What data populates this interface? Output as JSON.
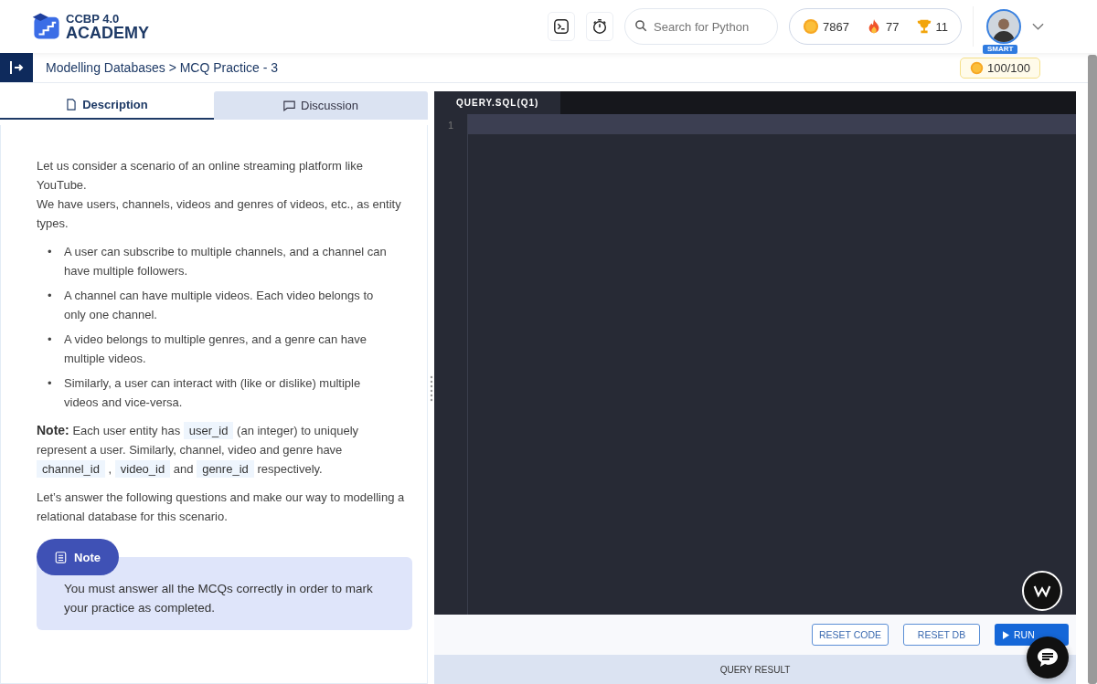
{
  "header": {
    "logo_top": "CCBP 4.0",
    "logo_bottom": "ACADEMY",
    "search": {
      "placeholder": "Search for Python"
    },
    "stats": [
      {
        "kind": "xp",
        "value": "7867"
      },
      {
        "kind": "streak",
        "value": "77"
      },
      {
        "kind": "trophy",
        "value": "11"
      }
    ],
    "avatar_badge": "SMART"
  },
  "breadcrumb": "Modelling Databases > MCQ Practice - 3",
  "xp_earned": "100/100",
  "tabs": [
    {
      "label": "Description",
      "kind": "doc",
      "selected": true
    },
    {
      "label": "Discussion",
      "kind": "chat",
      "selected": false
    }
  ],
  "description": {
    "intro": [
      "Let us consider a scenario of an online streaming platform like YouTube.",
      "We have users, channels, videos and genres of videos, etc., as entity types."
    ],
    "bullets": [
      {
        "marker": "•",
        "text": "A user can subscribe to multiple channels, and a channel can have multiple followers."
      },
      {
        "marker": "•",
        "text": "A channel can have multiple videos. Each video belongs to only one channel."
      },
      {
        "marker": "•",
        "text": "A video belongs to multiple genres, and a genre can have multiple videos."
      },
      {
        "marker": "•",
        "text": "Similarly, a user can interact with (like or dislike) multiple videos and vice-versa."
      }
    ],
    "note_paragraph": [
      {
        "kind": "text",
        "text": "**Note:** Each user entity has"
      },
      {
        "kind": "code",
        "text": "user_id"
      },
      {
        "kind": "text",
        "text": "(an integer) to uniquely represent a user. Similarly, channel, video and genre have"
      },
      {
        "kind": "code",
        "text": "channel_id"
      },
      {
        "kind": "text",
        "text": ","
      },
      {
        "kind": "code",
        "text": "video_id"
      },
      {
        "kind": "text",
        "text": "and"
      },
      {
        "kind": "code",
        "text": "genre_id"
      },
      {
        "kind": "text",
        "text": "respectively."
      }
    ],
    "closing": "Let’s answer the following questions and make our way to modelling a relational database for this scenario.",
    "note_box": {
      "title": "Note",
      "text": "You must answer all the MCQs correctly in order to mark your practice as completed."
    }
  },
  "editor": {
    "tab": "QUERY.SQL(Q1)",
    "line_numbers": [
      "1"
    ]
  },
  "buttons": [
    {
      "label": "RESET CODE",
      "kind": "outline"
    },
    {
      "label": "RESET DB",
      "kind": "outline"
    },
    {
      "label": "RUN",
      "kind": "primary"
    }
  ],
  "result_bar": "QUERY RESULT"
}
